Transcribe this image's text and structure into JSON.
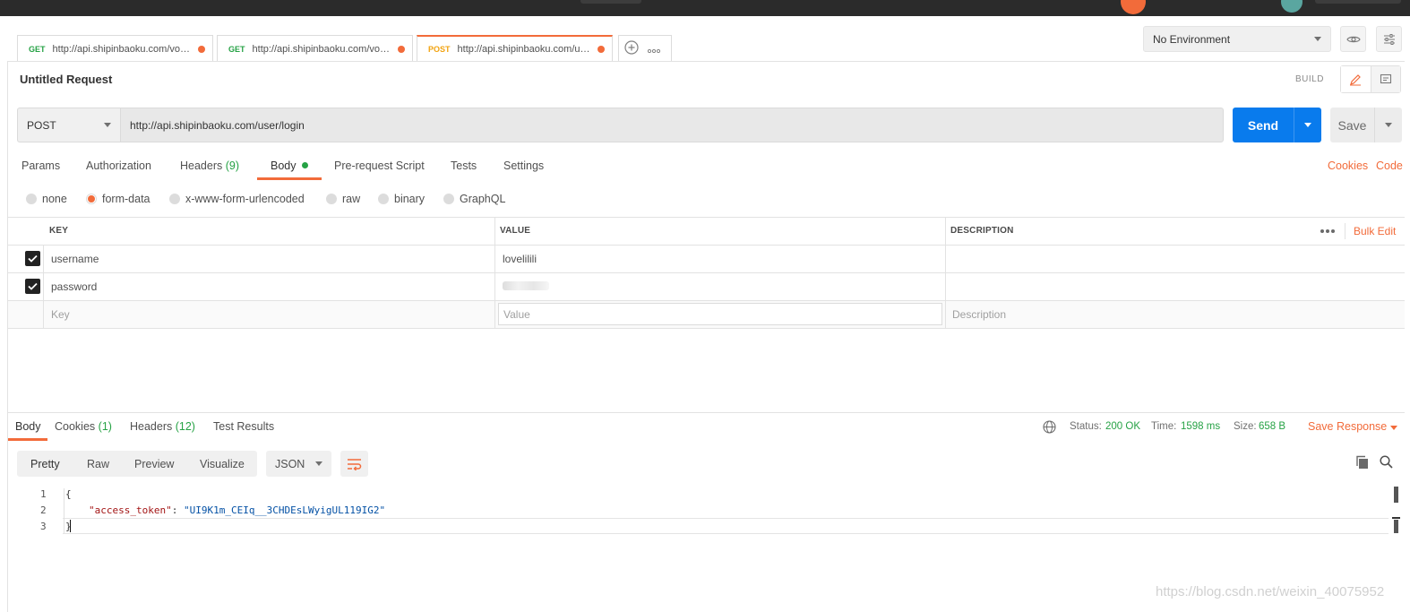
{
  "tabs": [
    {
      "method": "GET",
      "url": "http://api.shipinbaoku.com/vod..."
    },
    {
      "method": "GET",
      "url": "http://api.shipinbaoku.com/vod..."
    },
    {
      "method": "POST",
      "url": "http://api.shipinbaoku.com/us..."
    }
  ],
  "environment": {
    "selected": "No Environment"
  },
  "request": {
    "name": "Untitled Request",
    "mode_label": "BUILD",
    "method": "POST",
    "url": "http://api.shipinbaoku.com/user/login",
    "send_label": "Send",
    "save_label": "Save"
  },
  "request_tabs": {
    "params": "Params",
    "authorization": "Authorization",
    "headers": "Headers",
    "headers_count": "(9)",
    "body": "Body",
    "prerequest": "Pre-request Script",
    "tests": "Tests",
    "settings": "Settings",
    "cookies": "Cookies",
    "code": "Code"
  },
  "body_types": {
    "none": "none",
    "form_data": "form-data",
    "urlencoded": "x-www-form-urlencoded",
    "raw": "raw",
    "binary": "binary",
    "graphql": "GraphQL",
    "selected": "form-data"
  },
  "form_table": {
    "headers": {
      "key": "KEY",
      "value": "VALUE",
      "description": "DESCRIPTION",
      "bulk_edit": "Bulk Edit"
    },
    "rows": [
      {
        "checked": true,
        "key": "username",
        "value": "lovelilili",
        "description": ""
      },
      {
        "checked": true,
        "key": "password",
        "value": "",
        "description": ""
      }
    ],
    "placeholders": {
      "key": "Key",
      "value": "Value",
      "description": "Description"
    }
  },
  "response": {
    "tabs": {
      "body": "Body",
      "cookies": "Cookies",
      "cookies_count": "(1)",
      "headers": "Headers",
      "headers_count": "(12)",
      "test_results": "Test Results"
    },
    "status_label": "Status:",
    "status_value": "200 OK",
    "time_label": "Time:",
    "time_value": "1598 ms",
    "size_label": "Size:",
    "size_value": "658 B",
    "save_response": "Save Response",
    "views": {
      "pretty": "Pretty",
      "raw": "Raw",
      "preview": "Preview",
      "visualize": "Visualize"
    },
    "format": "JSON",
    "code_lines": [
      {
        "n": "1",
        "text": "{"
      },
      {
        "n": "2",
        "key": "\"access_token\"",
        "colon": ": ",
        "value": "\"UI9K1m_CEIq__3CHDEsLWyigUL119IG2\""
      },
      {
        "n": "3",
        "text": "}"
      }
    ]
  },
  "colors": {
    "accent": "#f26b3a",
    "send": "#097bed",
    "success": "#26a245"
  },
  "watermark": "https://blog.csdn.net/weixin_40075952"
}
